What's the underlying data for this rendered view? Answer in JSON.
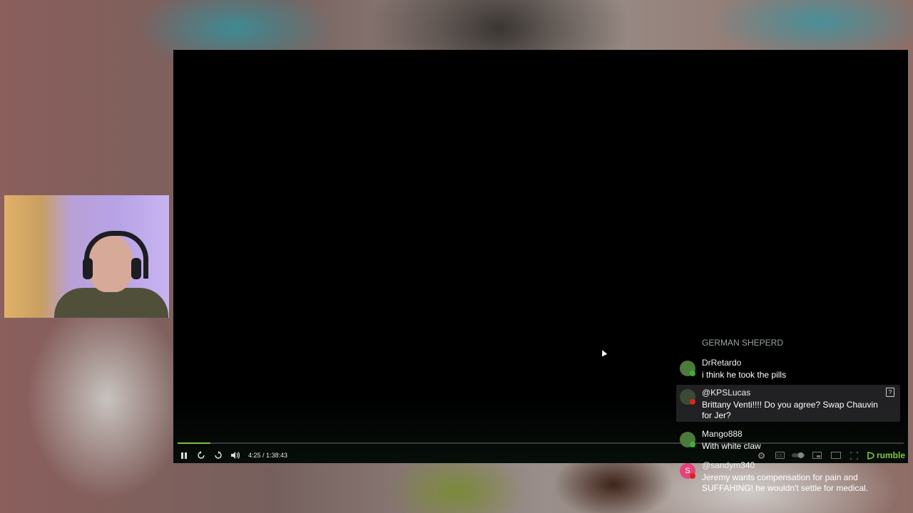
{
  "player": {
    "time_display": "4:25 / 1:38:43",
    "progress": 0.045,
    "brand": "rumble",
    "controls": {
      "left": [
        "pause-icon",
        "rewind-icon",
        "forward-icon",
        "volume-icon"
      ],
      "right": [
        "settings-icon",
        "captions-icon",
        "autoplay-toggle-icon",
        "miniplayer-icon",
        "theater-icon",
        "fullscreen-icon"
      ]
    },
    "accent_color": "#75c043"
  },
  "chat": {
    "faded_message": "GERMAN SHEPERD",
    "messages": [
      {
        "username": "DrRetardo",
        "text": "i think he took the pills",
        "avatar_color": "#4c7a3a",
        "badge_color": "#3fae3a"
      },
      {
        "username": "@KPSLucas",
        "text": "Brittany Venti!!!! Do you agree? Swap Chauvin for Jer?",
        "avatar_color": "#3a4a34",
        "badge_color": "#e02020"
      },
      {
        "username": "Mango888",
        "text": "With white claw",
        "avatar_color": "#4c7a3a",
        "badge_color": "#3fae3a"
      },
      {
        "username": "@sandym340",
        "text": "Jeremy wants compensation for pain and SUFFAHING! he wouldn't settle for medical.",
        "avatar_letter": "S",
        "avatar_color": "#e3457a",
        "badge_color": "#e02020"
      }
    ]
  }
}
